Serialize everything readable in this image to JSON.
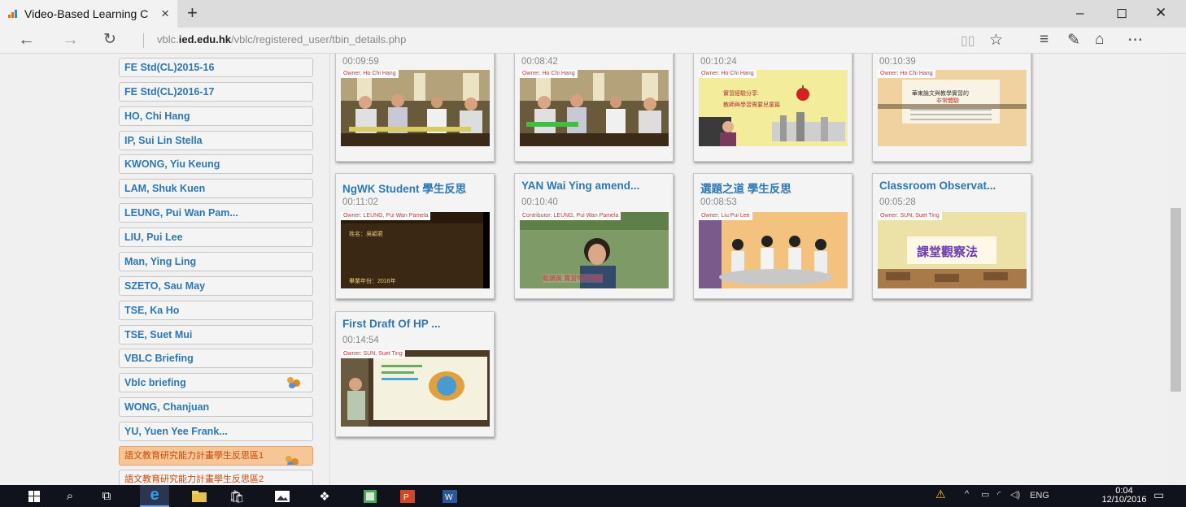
{
  "browser": {
    "tab_title": "Video-Based Learning C",
    "tab_close": "×",
    "new_tab": "+",
    "url_prefix": "vblc.",
    "url_domain": "ied.edu.hk",
    "url_path": "/vblc/registered_user/tbin_details.php"
  },
  "window": {
    "minimize": "–",
    "maximize": "◻",
    "close": "✕"
  },
  "sidebar": {
    "items": [
      {
        "label": "FE Std(CL)2015-16"
      },
      {
        "label": "FE Std(CL)2016-17"
      },
      {
        "label": "HO, Chi Hang"
      },
      {
        "label": "IP, Sui Lin Stella"
      },
      {
        "label": "KWONG, Yiu Keung"
      },
      {
        "label": "LAM, Shuk Kuen"
      },
      {
        "label": "LEUNG, Pui Wan Pam..."
      },
      {
        "label": "LIU, Pui Lee"
      },
      {
        "label": "Man, Ying Ling"
      },
      {
        "label": "SZETO, Sau May"
      },
      {
        "label": "TSE, Ka Ho"
      },
      {
        "label": "TSE, Suet Mui"
      },
      {
        "label": "VBLC Briefing"
      },
      {
        "label": "Vblc briefing"
      },
      {
        "label": "WONG, Chanjuan"
      },
      {
        "label": "YU, Yuen Yee Frank..."
      },
      {
        "label": "語文教育研究能力計畫學生反思區1"
      },
      {
        "label": "語文教育研究能力計畫學生反思區2"
      }
    ]
  },
  "videos": [
    {
      "title": "",
      "duration": "00:09:59",
      "owner": "Owner: Ho Chi Hang"
    },
    {
      "title": "",
      "duration": "00:08:42",
      "owner": "Owner: Ho Chi Hang"
    },
    {
      "title": "",
      "duration": "00:10:24",
      "owner": "Owner: Ho Chi Hang",
      "thumb_text": "實習經驗分享:",
      "thumb_text2": "教師與學習需要兒童篇"
    },
    {
      "title": "",
      "duration": "00:10:39",
      "owner": "Owner: Ho Chi Hang",
      "thumb_text": "華東論文與教學實習的",
      "thumb_text2": "非常體驗"
    },
    {
      "title": "NgWK Student 學生反思",
      "duration": "00:11:02",
      "owner": "Owner: LEUNG, Pui Wan Pamela",
      "thumb_text": "姓名：吳穎君",
      "thumb_text2": "畢業年份：2016年"
    },
    {
      "title": "YAN Wai Ying amend...",
      "duration": "00:10:40",
      "owner": "Contributor: LEUNG, Pui Wan Pamela",
      "thumb_text": "甄穎英  實習學校經驗"
    },
    {
      "title": "選題之道 學生反思",
      "duration": "00:08:53",
      "owner": "Owner: Liu Pui Lee"
    },
    {
      "title": "Classroom Observat...",
      "duration": "00:05:28",
      "owner": "Owner: SUN, Suet Ting",
      "thumb_text": "課堂觀察法"
    },
    {
      "title": "First Draft Of HP ...",
      "duration": "00:14:54",
      "owner": "Owner: SUN, Suet Ting"
    }
  ],
  "taskbar": {
    "lang": "ENG",
    "time": "0:04",
    "date": "12/10/2016"
  }
}
